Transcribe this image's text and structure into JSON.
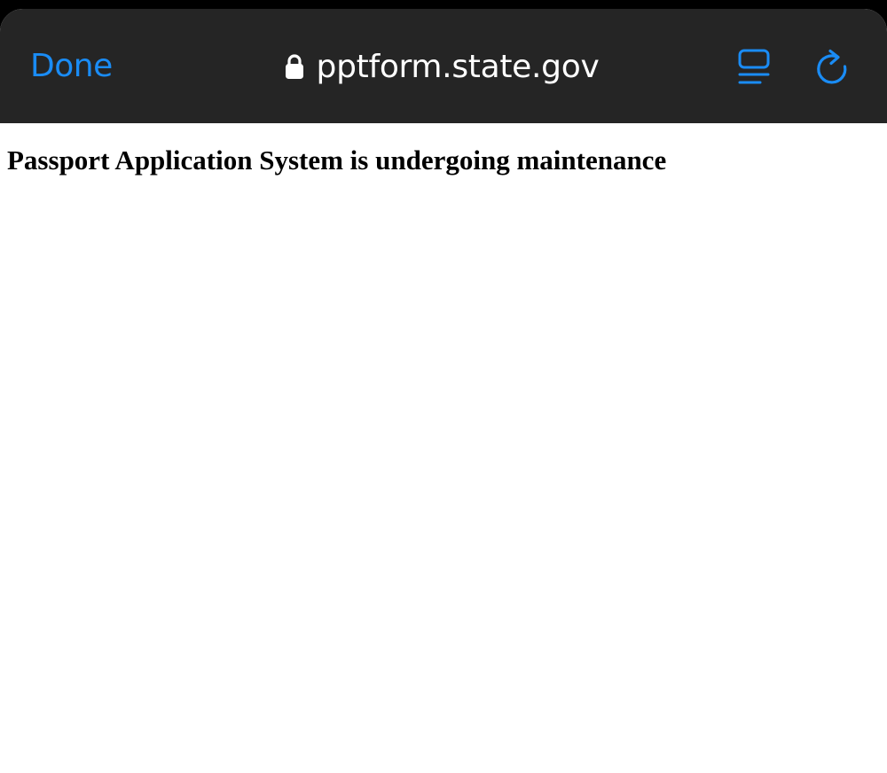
{
  "toolbar": {
    "done_label": "Done",
    "url": "pptform.state.gov",
    "lock_icon": "lock-icon",
    "reader_icon": "reader-mode-icon",
    "reload_icon": "reload-icon",
    "accent_color": "#1a8cf5",
    "background_color": "#252525"
  },
  "page": {
    "heading": "Passport Application System is undergoing maintenance"
  }
}
